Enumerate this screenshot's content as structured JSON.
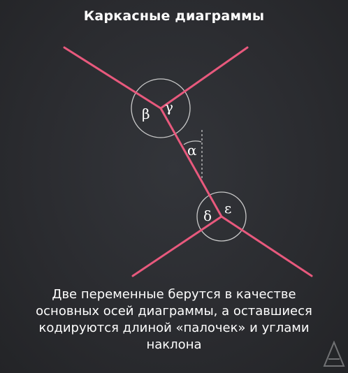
{
  "title": "Каркасные диаграммы",
  "angles": {
    "beta": "β",
    "gamma": "γ",
    "alpha": "α",
    "delta": "δ",
    "epsilon": "ε"
  },
  "caption": {
    "line1": "Две переменные берутся в качестве",
    "line2": "основных осей диаграммы, а оставшиеся",
    "line3": "кодируются длиной «палочек» и углами",
    "line4": "наклона"
  },
  "colors": {
    "stick": "#e8597d",
    "circle": "#c9c9c9",
    "background": "#2b2c30",
    "text": "#ffffff"
  }
}
